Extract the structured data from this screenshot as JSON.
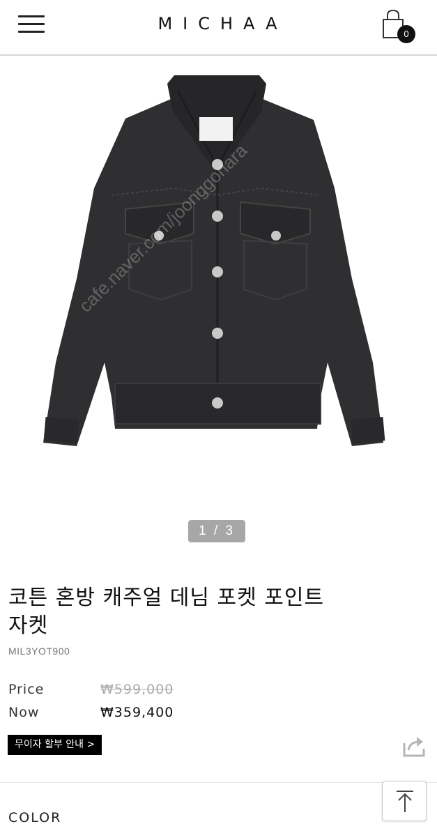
{
  "header": {
    "brand": "MICHAA",
    "cart_count": "0"
  },
  "gallery": {
    "pager": "1 / 3",
    "watermark_text": "cafe.naver.com/joonggonara"
  },
  "product": {
    "title_line1": "코튼 혼방 캐주얼 데님 포켓 포인트",
    "title_line2": "자켓",
    "code": "MIL3YOT900",
    "price_label": "Price",
    "price": "₩599,000",
    "now_label": "Now",
    "now_price": "₩359,400",
    "installment_button": "무이자 할부 안내 >"
  },
  "options": {
    "color_label": "COLOR"
  },
  "colors": {
    "jacket": "#2f2f31",
    "accent": "#000000",
    "pager_bg": "#a7a7a7"
  }
}
